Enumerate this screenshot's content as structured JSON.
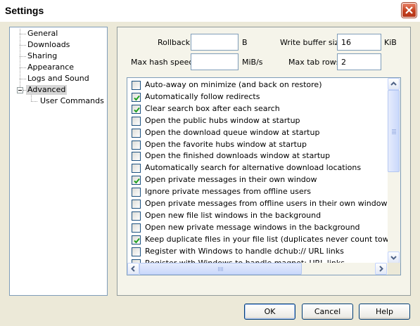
{
  "window": {
    "title": "Settings"
  },
  "tree": {
    "items": [
      "General",
      "Downloads",
      "Sharing",
      "Appearance",
      "Logs and Sound",
      "Advanced"
    ],
    "children": [
      "User Commands"
    ],
    "selected": "Advanced"
  },
  "fields": {
    "rollback": {
      "label": "Rollback",
      "value": "",
      "unit": "B"
    },
    "write_buffer": {
      "label": "Write buffer size",
      "value": "16",
      "unit": "KiB"
    },
    "max_hash": {
      "label": "Max hash speed",
      "value": "",
      "unit": "MiB/s"
    },
    "max_tab_rows": {
      "label": "Max tab rows",
      "value": "2"
    }
  },
  "options": [
    {
      "label": "Auto-away on minimize (and back on restore)",
      "checked": false
    },
    {
      "label": "Automatically follow redirects",
      "checked": true
    },
    {
      "label": "Clear search box after each search",
      "checked": true
    },
    {
      "label": "Open the public hubs window at startup",
      "checked": false
    },
    {
      "label": "Open the download queue window at startup",
      "checked": false
    },
    {
      "label": "Open the favorite hubs window at startup",
      "checked": false
    },
    {
      "label": "Open the finished downloads window at startup",
      "checked": false
    },
    {
      "label": "Automatically search for alternative download locations",
      "checked": false
    },
    {
      "label": "Open private messages in their own window",
      "checked": true
    },
    {
      "label": "Ignore private messages from offline users",
      "checked": false
    },
    {
      "label": "Open private messages from offline users in their own window",
      "checked": false
    },
    {
      "label": "Open new file list windows in the background",
      "checked": false
    },
    {
      "label": "Open new private message windows in the background",
      "checked": false
    },
    {
      "label": "Keep duplicate files in your file list (duplicates never count towards your share)",
      "checked": true
    },
    {
      "label": "Register with Windows to handle dchub:// URL links",
      "checked": false
    },
    {
      "label": "Register with Windows to handle magnet: URL links",
      "checked": false
    }
  ],
  "buttons": {
    "ok": "OK",
    "cancel": "Cancel",
    "help": "Help"
  },
  "icons": {
    "close": "close-icon",
    "check": "check-icon",
    "expander": "minus-icon",
    "scroll_up": "arrow-up-icon",
    "scroll_down": "arrow-down-icon",
    "scroll_left": "arrow-left-icon",
    "scroll_right": "arrow-right-icon"
  },
  "colors": {
    "close_button": "#c4411f",
    "list_border": "#7f9db9",
    "dialog_bg": "#ece9d8"
  }
}
